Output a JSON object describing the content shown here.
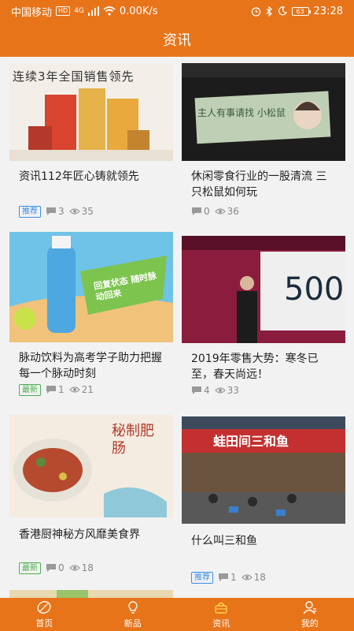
{
  "status_bar": {
    "carrier": "中国移动",
    "hd": "HD",
    "network": "4G",
    "speed": "0.00K/s",
    "battery": "63",
    "time": "23:28"
  },
  "header": {
    "title": "资讯"
  },
  "cards": [
    {
      "image_text": "连续3年全国销售领先",
      "title": "资讯112年匠心铸就领先",
      "tag": "推荐",
      "comments": "3",
      "views": "35"
    },
    {
      "image_text": "主人有事请找 小松鼠",
      "title": "休闲零食行业的一股清流 三只松鼠如何玩",
      "tag": "",
      "comments": "0",
      "views": "36"
    },
    {
      "image_text": "回复状态 随时脉动回来",
      "title": "脉动饮料为高考学子助力把握每一个脉动时刻",
      "tag": "最新",
      "comments": "1",
      "views": "21"
    },
    {
      "image_text": "500",
      "title": "2019年零售大势：寒冬已至，春天尚远！",
      "tag": "",
      "comments": "4",
      "views": "33"
    },
    {
      "image_text": "秘制肥肠",
      "title": "香港厨神秘方风靡美食界",
      "tag": "最新",
      "comments": "0",
      "views": "18"
    },
    {
      "image_text": "蛙田间三和鱼",
      "title": "什么叫三和鱼",
      "tag": "推荐",
      "comments": "1",
      "views": "18"
    }
  ],
  "tabs": [
    {
      "label": "首页",
      "icon": "leaf-icon"
    },
    {
      "label": "新品",
      "icon": "bulb-icon"
    },
    {
      "label": "资讯",
      "icon": "basket-icon"
    },
    {
      "label": "我的",
      "icon": "user-icon"
    }
  ],
  "colors": {
    "primary": "#e8741a",
    "tag_blue": "#3a8ee6",
    "tag_green": "#4caf50"
  }
}
